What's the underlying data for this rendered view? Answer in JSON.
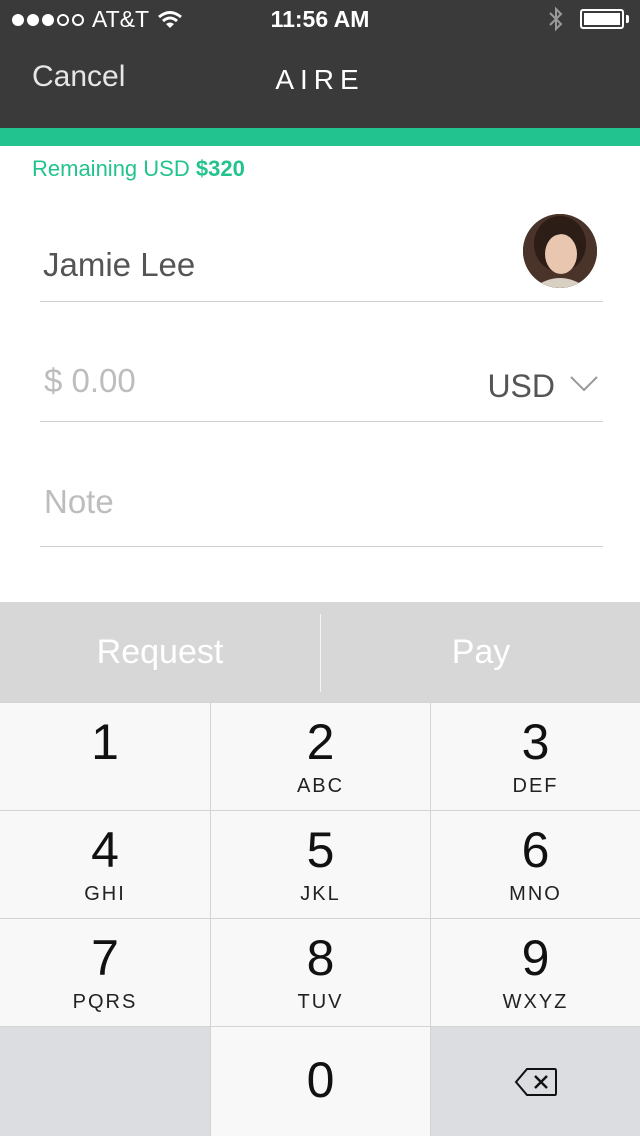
{
  "status_bar": {
    "carrier": "AT&T",
    "time": "11:56 AM"
  },
  "nav": {
    "cancel_label": "Cancel",
    "title": "AIRE"
  },
  "balance": {
    "prefix": "Remaining USD",
    "amount": "$320"
  },
  "form": {
    "recipient_name": "Jamie Lee",
    "amount_placeholder": "$ 0.00",
    "currency": "USD",
    "note_placeholder": "Note"
  },
  "actions": {
    "request_label": "Request",
    "pay_label": "Pay"
  },
  "keypad": {
    "keys": [
      {
        "digit": "1",
        "letters": ""
      },
      {
        "digit": "2",
        "letters": "ABC"
      },
      {
        "digit": "3",
        "letters": "DEF"
      },
      {
        "digit": "4",
        "letters": "GHI"
      },
      {
        "digit": "5",
        "letters": "JKL"
      },
      {
        "digit": "6",
        "letters": "MNO"
      },
      {
        "digit": "7",
        "letters": "PQRS"
      },
      {
        "digit": "8",
        "letters": "TUV"
      },
      {
        "digit": "9",
        "letters": "WXYZ"
      },
      {
        "digit": "0",
        "letters": ""
      }
    ],
    "delete_icon": "backspace-icon"
  },
  "colors": {
    "accent": "#22c38e",
    "nav_bg": "#3a3a3a",
    "action_bg": "#d7d7d7"
  }
}
